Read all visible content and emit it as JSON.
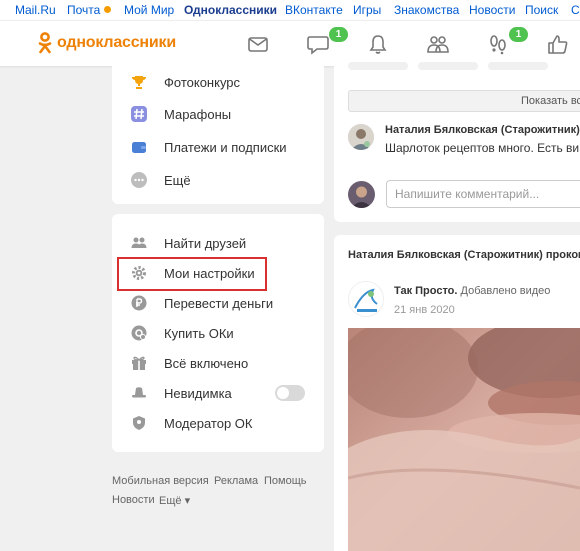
{
  "topnav": {
    "items": [
      "Mail.Ru",
      "Почта",
      "Мой Мир",
      "Одноклассники",
      "ВКонтакте",
      "Игры",
      "Знакомства",
      "Новости",
      "Поиск",
      "С"
    ]
  },
  "header": {
    "logo_text": "одноклассники",
    "discussions_badge": "1",
    "guests_badge": "1"
  },
  "menu_top": [
    "Фотоконкурс",
    "Марафоны",
    "Платежи и подписки",
    "Ещё"
  ],
  "menu_settings": [
    "Найти друзей",
    "Мои настройки",
    "Перевести деньги",
    "Купить ОКи",
    "Всё включено",
    "Невидимка",
    "Модератор ОК"
  ],
  "footer": {
    "mobile": "Мобильная версия",
    "ads": "Реклама",
    "help": "Помощь",
    "news": "Новости",
    "more": "Ещё"
  },
  "feed": {
    "show_more": "Показать вс",
    "comment_author": "Наталия Бялковская (Старожитник)",
    "comment_text": "Шарлоток рецептов много. Есть ви",
    "comment_placeholder": "Напишите комментарий...",
    "post_header": "Наталия Бялковская (Старожитник) проком",
    "group_name": "Так Просто.",
    "action": "Добавлено видео",
    "date": "21 янв 2020"
  },
  "colors": {
    "accent": "#ee8208",
    "badge": "#4fc24f",
    "highlight": "#d83030",
    "link": "#005bd1"
  }
}
